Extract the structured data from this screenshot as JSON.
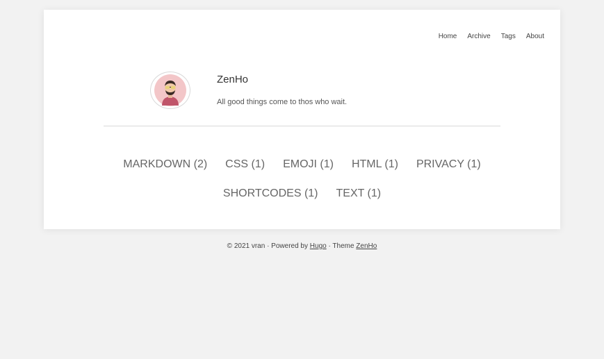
{
  "nav": {
    "items": [
      {
        "label": "Home"
      },
      {
        "label": "Archive"
      },
      {
        "label": "Tags"
      },
      {
        "label": "About"
      }
    ]
  },
  "profile": {
    "title": "ZenHo",
    "description": "All good things come to thos who wait.",
    "avatar_icon": "person-avatar-icon"
  },
  "tags": [
    {
      "label": "MARKDOWN (2)"
    },
    {
      "label": "CSS (1)"
    },
    {
      "label": "EMOJI (1)"
    },
    {
      "label": "HTML (1)"
    },
    {
      "label": "PRIVACY (1)"
    },
    {
      "label": "SHORTCODES (1)"
    },
    {
      "label": "TEXT (1)"
    }
  ],
  "footer": {
    "copyright": "© 2021 vran · Powered by ",
    "hugo_link": "Hugo",
    "theme_text": " · Theme ",
    "theme_link": "ZenHo"
  },
  "colors": {
    "page_bg": "#f2f2f2",
    "card_bg": "#ffffff",
    "avatar_bg": "#f3c6c8",
    "shirt": "#c0556a"
  }
}
